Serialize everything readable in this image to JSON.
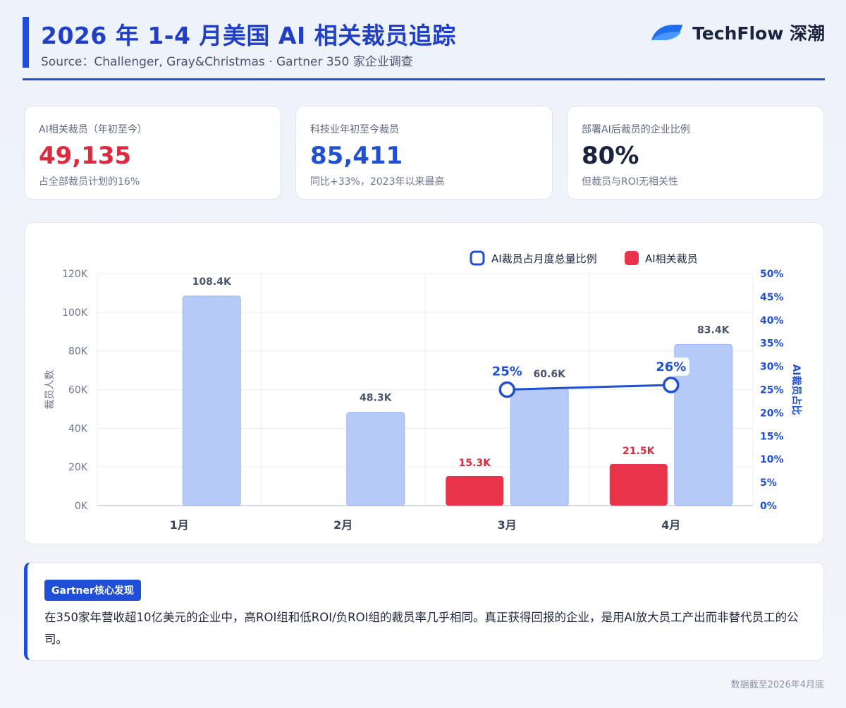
{
  "header": {
    "title": "2026 年 1-4 月美国 AI 相关裁员追踪",
    "subtitle": "Source：Challenger, Gray&Christmas · Gartner 350 家企业调查",
    "brand": "TechFlow 深潮"
  },
  "kpis": [
    {
      "label": "AI相关裁员（年初至今）",
      "value": "49,135",
      "note": "占全部裁员计划的16%",
      "color": "#e0283f"
    },
    {
      "label": "科技业年初至今裁员",
      "value": "85,411",
      "note": "同比+33%，2023年以来最高",
      "color": "#1f4fd6"
    },
    {
      "label": "部署AI后裁员的企业比例",
      "value": "80%",
      "note": "但裁员与ROI无相关性",
      "color": "#1a2340"
    }
  ],
  "chart_data": {
    "type": "bar",
    "categories": [
      "1月",
      "2月",
      "3月",
      "4月"
    ],
    "series": [
      {
        "name": "AI相关裁员",
        "values": [
          null,
          null,
          15.3,
          21.5
        ],
        "labels": [
          "",
          "",
          "15.3K",
          "21.5K"
        ],
        "color": "#e8334b",
        "axis": "left"
      },
      {
        "name": "",
        "values": [
          108.4,
          48.3,
          60.6,
          83.4
        ],
        "labels": [
          "108.4K",
          "48.3K",
          "60.6K",
          "83.4K"
        ],
        "color": "#b6caf7",
        "axis": "left"
      },
      {
        "name": "AI裁员占月度总量比例",
        "type": "line",
        "values": [
          null,
          null,
          25,
          26
        ],
        "labels": [
          "",
          "",
          "25%",
          "26%"
        ],
        "color": "#1f4fd6",
        "axis": "right"
      }
    ],
    "ylabel": "裁员人数",
    "y2label": "AI裁员占比",
    "ylim": [
      0,
      120
    ],
    "y2lim": [
      0,
      50
    ],
    "yticks": [
      "0K",
      "20K",
      "40K",
      "60K",
      "80K",
      "100K",
      "120K"
    ],
    "y2ticks": [
      "0%",
      "5%",
      "10%",
      "15%",
      "20%",
      "25%",
      "30%",
      "35%",
      "40%",
      "45%",
      "50%"
    ],
    "grid": true,
    "legend": "top-right"
  },
  "finding": {
    "badge": "Gartner核心发现",
    "text": "在350家年营收超10亿美元的企业中，高ROI组和低ROI/负ROI组的裁员率几乎相同。真正获得回报的企业，是用AI放大员工产出而非替代员工的公司。"
  },
  "footnote": "数据截至2026年4月底"
}
